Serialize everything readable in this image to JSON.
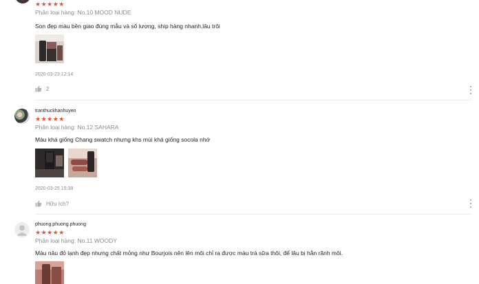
{
  "colors": {
    "star": "#ee4d2d",
    "muted_text": "#8a8a8a",
    "divider": "#ececec"
  },
  "reviews": [
    {
      "username": "",
      "avatar_icon": "user-photo-avatar",
      "stars": "★★★★★",
      "variation": "Phân loại hàng: No.10 MOOD NUDE",
      "comment": "Son đẹp màu bền giao đúng mẫu và số lượng, ship hàng nhanh,lâu trôi",
      "images": [
        "product-photo-lipstick"
      ],
      "time": "2020-03-23 12:14",
      "like_label": "2",
      "more_icon": "more-vertical-icon"
    },
    {
      "username": "tranthuckhanhuyen",
      "avatar_icon": "user-photo-avatar",
      "stars": "★★★★★",
      "variation": "Phân loại hàng: No.12 SAHARA",
      "comment": "Màu khá giống Chang swatch nhưng khs mùi khá giống socola nhớ",
      "images": [
        "product-photo-lipstick",
        "product-photo-swatch"
      ],
      "time": "2020-03-25 15:38",
      "like_label": "Hữu ích?",
      "more_icon": "more-vertical-icon"
    },
    {
      "username": "phuong.phuong.phuong",
      "avatar_icon": "default-user-icon",
      "stars": "★★★★★",
      "variation": "Phân loại hàng: No.11 WOODY",
      "comment": "Màu nâu đỏ lạnh đẹp nhưng chất mỏng như Bourjois nên lên môi chỉ ra được màu trà sữa thôi, để lâu bị hằn rãnh môi.",
      "images": [
        "product-photo-lipstick"
      ]
    }
  ]
}
